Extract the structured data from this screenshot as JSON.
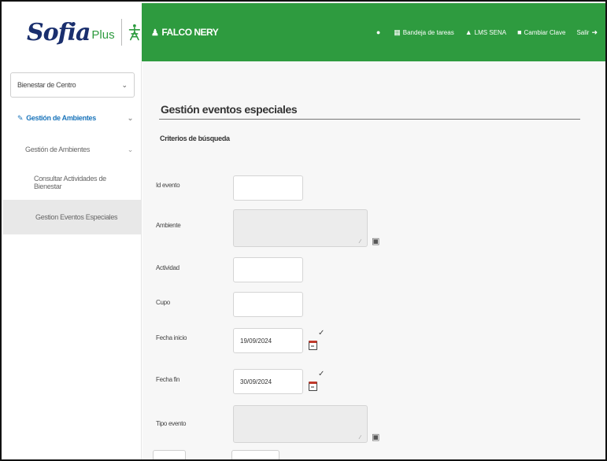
{
  "app": {
    "logo_text": "Sofia",
    "logo_plus": "Plus"
  },
  "header": {
    "user_name": "FALCO NERY",
    "nav": [
      {
        "label": "",
        "icon": "location-icon"
      },
      {
        "label": "Bandeja de tareas",
        "icon": "inbox-icon"
      },
      {
        "label": "LMS SENA",
        "icon": "graduation-cap-icon"
      },
      {
        "label": "Cambiar Clave",
        "icon": "lock-icon"
      },
      {
        "label": "Salir",
        "icon": "sign-out-icon"
      }
    ],
    "colors": {
      "topbar": "#2e9b3f",
      "logo": "#1a2f6e"
    }
  },
  "sidebar": {
    "role_select": "Bienestar de Centro",
    "items": [
      {
        "label": "Gestión de Ambientes",
        "level": 1
      },
      {
        "label": "Gestión de Ambientes",
        "level": 2
      },
      {
        "label": "Consultar Actividades de Bienestar",
        "level": 3
      },
      {
        "label": "Gestion Eventos Especiales",
        "level": 3,
        "active": true
      }
    ]
  },
  "main": {
    "title": "Gestión eventos especiales",
    "section": "Criterios de búsqueda",
    "fields": {
      "id_evento": {
        "label": "Id evento",
        "value": ""
      },
      "ambiente": {
        "label": "Ambiente",
        "value": ""
      },
      "actividad": {
        "label": "Actividad",
        "value": ""
      },
      "cupo": {
        "label": "Cupo",
        "value": ""
      },
      "fecha_inicio": {
        "label": "Fecha inicio",
        "value": "19/09/2024"
      },
      "fecha_fin": {
        "label": "Fecha fin",
        "value": "30/09/2024"
      },
      "tipo_evento": {
        "label": "Tipo evento",
        "value": ""
      }
    }
  }
}
